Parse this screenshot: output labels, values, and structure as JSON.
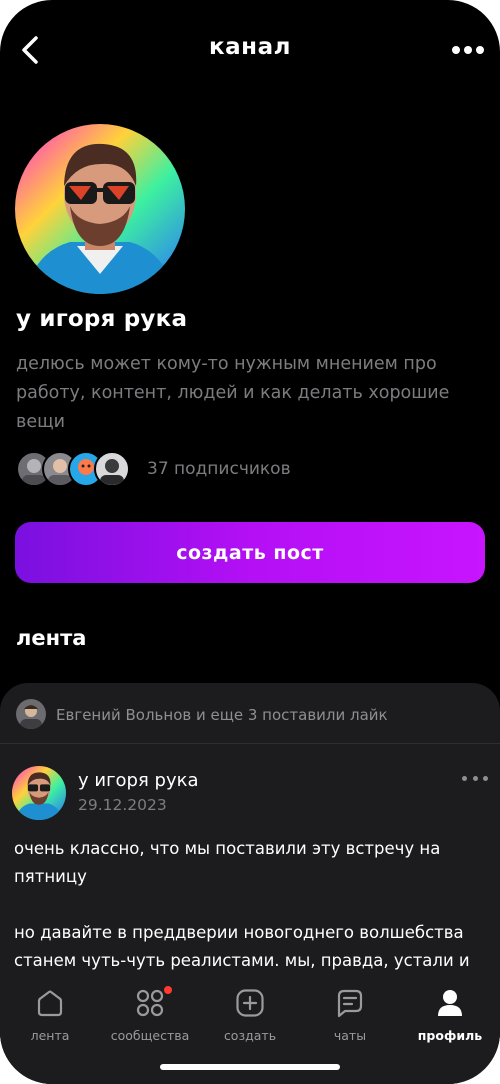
{
  "header": {
    "title": "канал"
  },
  "channel": {
    "title": "у игоря рука",
    "description": "делюсь может кому-то нужным мнением про работу, контент, людей и как делать хорошие вещи",
    "subscribers_label": "37 подписчиков"
  },
  "create_post_label": "создать пост",
  "feed": {
    "heading": "лента",
    "likes_text": "Евгений Вольнов и еще 3 поставили лайк",
    "post": {
      "author": "у игоря рука",
      "date": "29.12.2023",
      "paragraph1": "очень классно, что мы поставили эту встречу на пятницу",
      "paragraph2": "но давайте в преддверии новогоднего волшебства станем чуть-чуть реалистами. мы, правда, устали и нам,"
    }
  },
  "tabbar": {
    "items": [
      {
        "label": "лента",
        "icon": "home-icon"
      },
      {
        "label": "сообщества",
        "icon": "grid-icon"
      },
      {
        "label": "создать",
        "icon": "plus-square-icon"
      },
      {
        "label": "чаты",
        "icon": "chat-icon"
      },
      {
        "label": "профиль",
        "icon": "person-icon"
      }
    ],
    "active": "профиль"
  },
  "colors": {
    "accent_start": "#7a10e0",
    "accent_end": "#c814ff",
    "badge": "#ff3b30"
  }
}
